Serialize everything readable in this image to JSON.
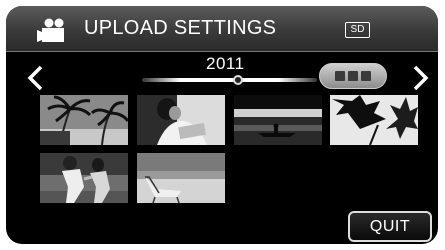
{
  "header": {
    "title": "UPLOAD SETTINGS",
    "mode_icon": "video-camera-icon",
    "media_badge": "SD"
  },
  "navigation": {
    "prev_icon": "chevron-left-icon",
    "next_icon": "chevron-right-icon",
    "year": "2011",
    "timeline_position": 0.55,
    "pager_icon": "page-jump-icon"
  },
  "thumbnails": [
    {
      "scene": "palm-trees-beach"
    },
    {
      "scene": "woman-with-laptop"
    },
    {
      "scene": "canoe-on-lake"
    },
    {
      "scene": "maple-leaves"
    },
    {
      "scene": "couple-jogging"
    },
    {
      "scene": "beach-chair"
    }
  ],
  "actions": {
    "quit_label": "QUIT"
  },
  "colors": {
    "background": "#000000",
    "header": "#3a3a3a",
    "text": "#ffffff"
  }
}
